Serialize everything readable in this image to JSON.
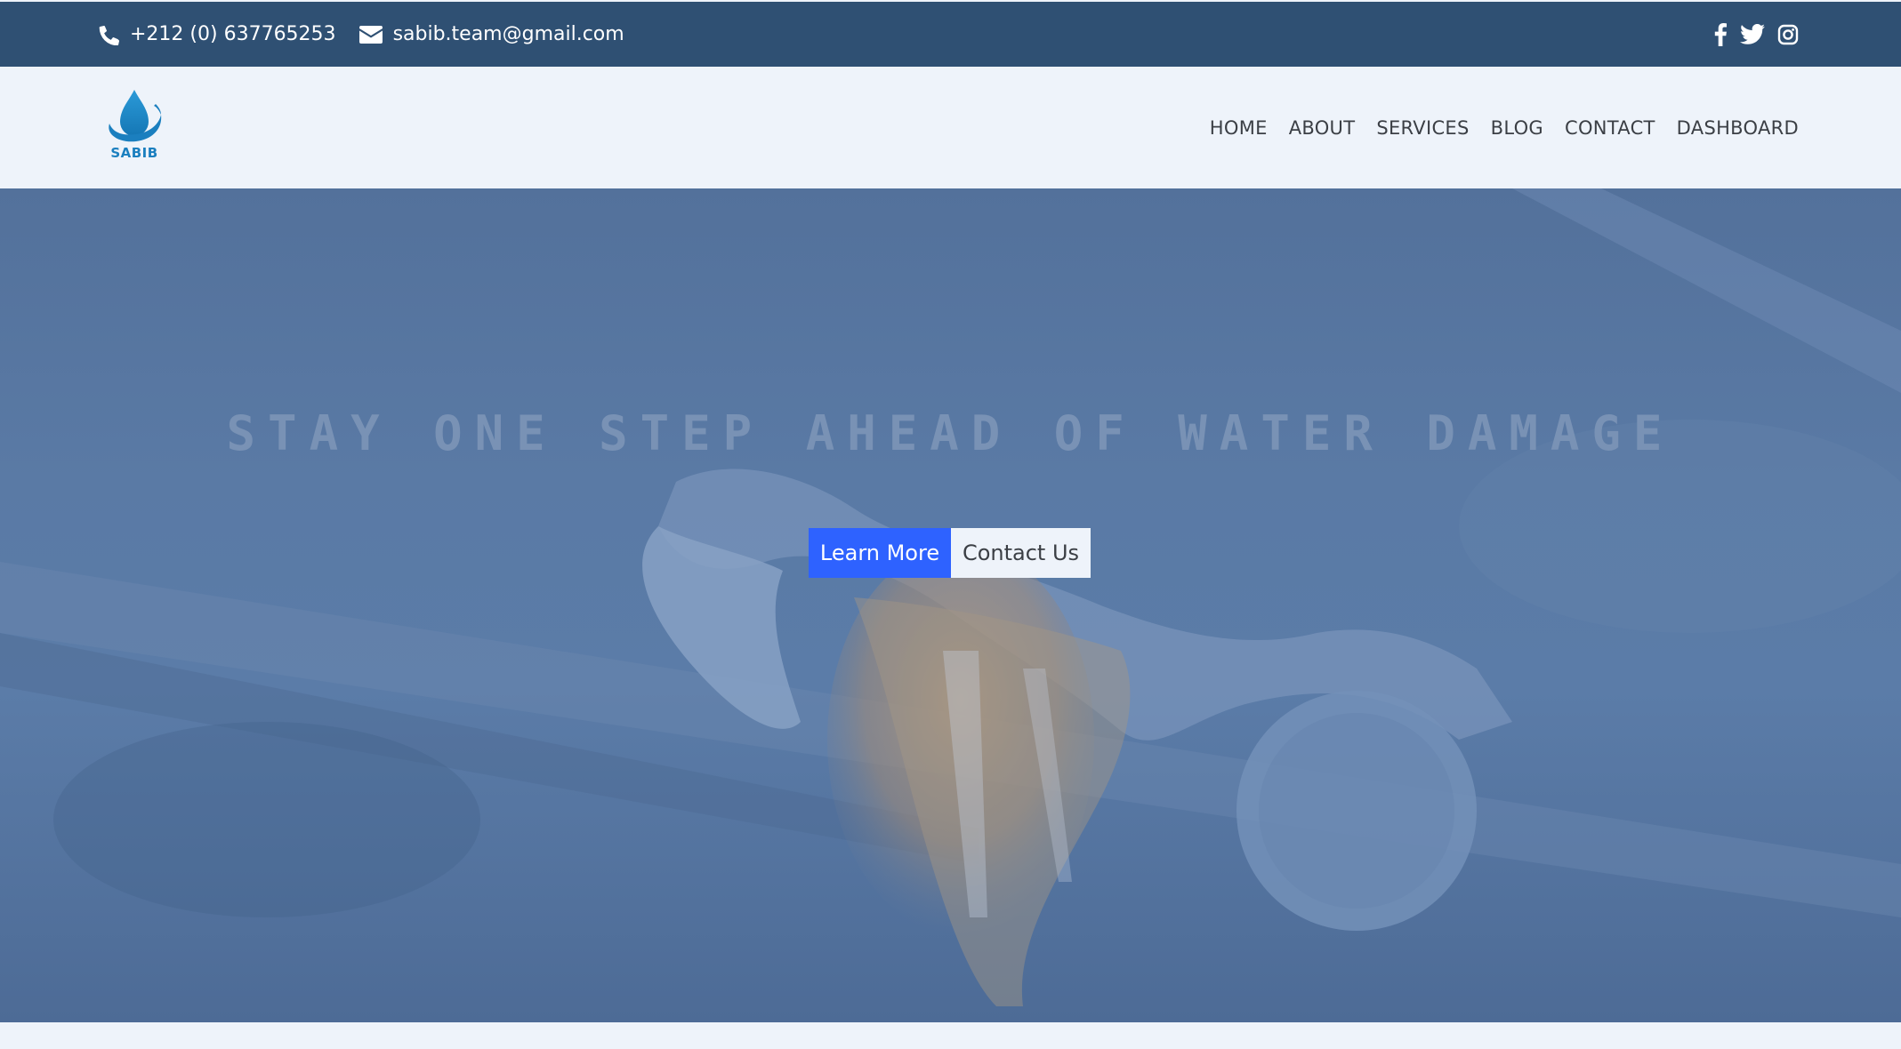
{
  "topbar": {
    "phone": "+212 (0) 637765253",
    "email": "sabib.team@gmail.com",
    "socials": [
      "facebook-icon",
      "twitter-icon",
      "instagram-icon"
    ]
  },
  "brand": {
    "name": "SABIB"
  },
  "nav": {
    "items": [
      {
        "label": "HOME"
      },
      {
        "label": "ABOUT"
      },
      {
        "label": "SERVICES"
      },
      {
        "label": "BLOG"
      },
      {
        "label": "CONTACT"
      },
      {
        "label": "DASHBOARD"
      }
    ]
  },
  "hero": {
    "title": "STAY ONE STEP AHEAD OF WATER DAMAGE",
    "primary_button": "Learn More",
    "secondary_button": "Contact Us"
  },
  "colors": {
    "topbar": "#2f5073",
    "header": "#eef3fa",
    "hero_overlay": "#5a7aa5",
    "primary_button": "#2e62ff",
    "logo": "#1b7fbf",
    "nav_text": "#3b3f45"
  }
}
